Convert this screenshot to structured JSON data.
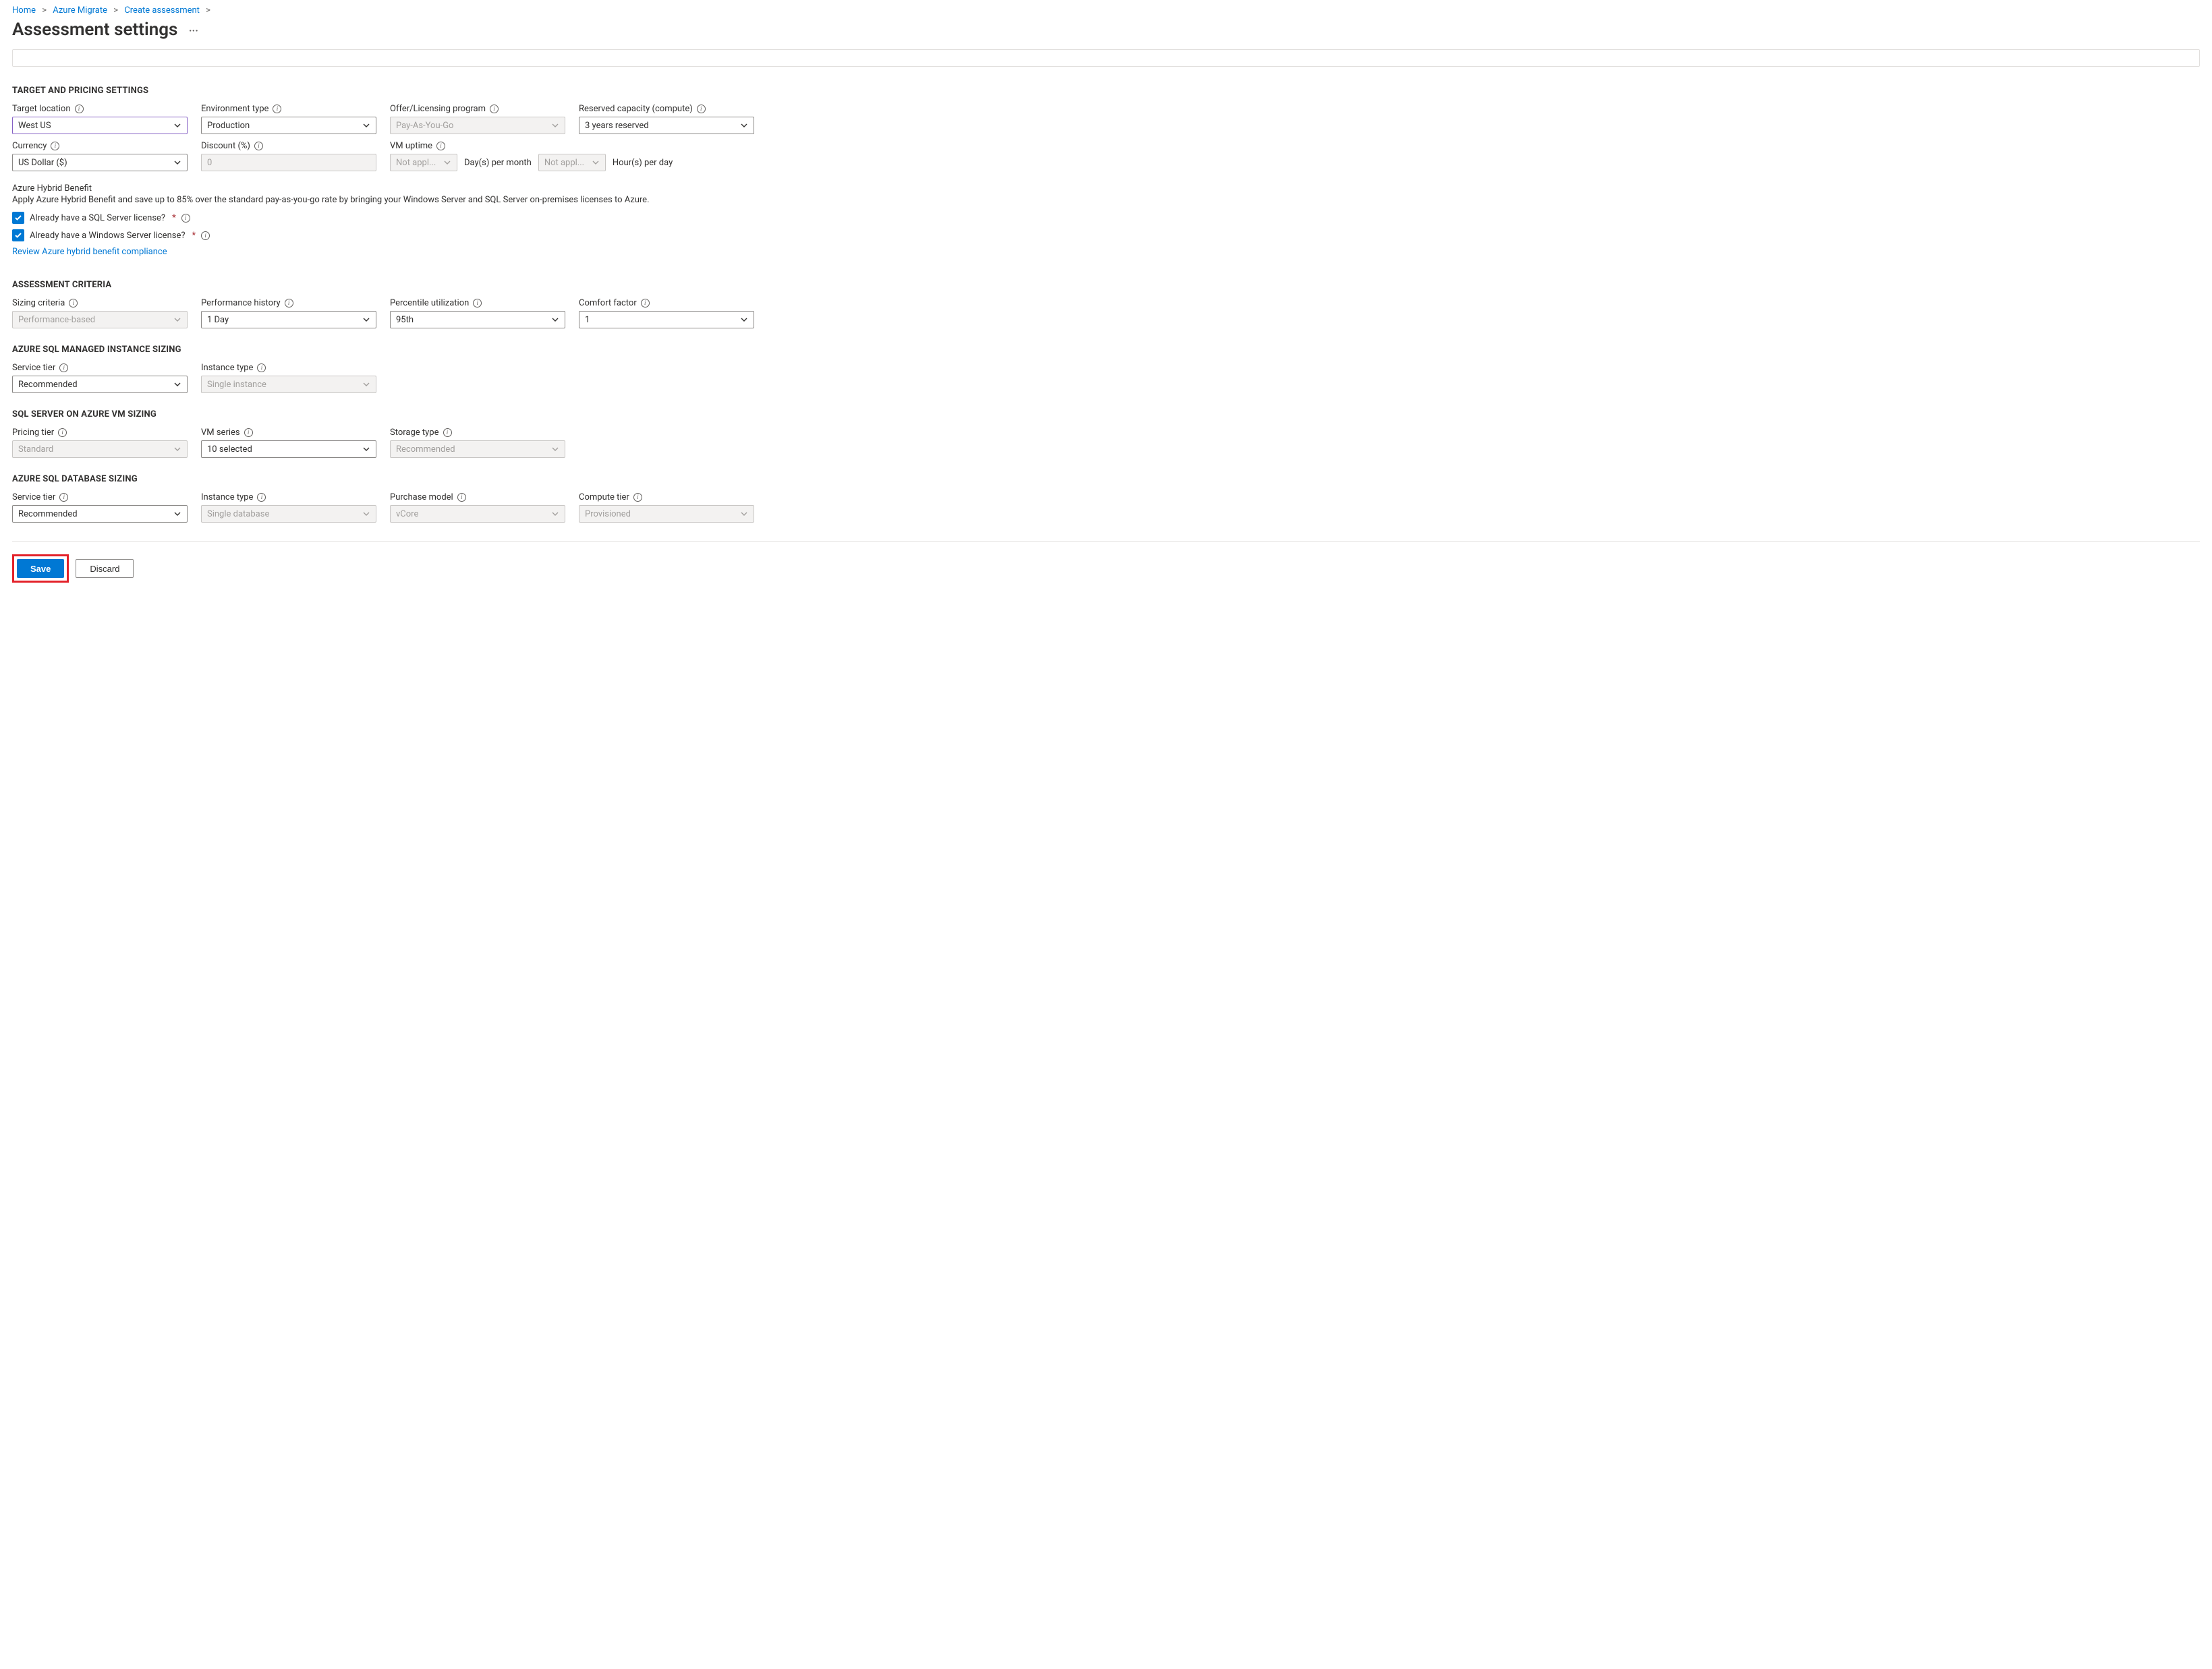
{
  "breadcrumb": {
    "home": "Home",
    "azure_migrate": "Azure Migrate",
    "create_assessment": "Create assessment"
  },
  "title": "Assessment settings",
  "more_glyph": "···",
  "topbox_content": "",
  "sections": {
    "target_pricing": "TARGET AND PRICING SETTINGS",
    "assessment_criteria": "ASSESSMENT CRITERIA",
    "mi_sizing": "AZURE SQL MANAGED INSTANCE SIZING",
    "vm_sizing": "SQL SERVER ON AZURE VM SIZING",
    "db_sizing": "AZURE SQL DATABASE SIZING"
  },
  "fields": {
    "target_location": {
      "label": "Target location",
      "value": "West US"
    },
    "environment_type": {
      "label": "Environment type",
      "value": "Production"
    },
    "offer_program": {
      "label": "Offer/Licensing program",
      "value": "Pay-As-You-Go"
    },
    "reserved_capacity": {
      "label": "Reserved capacity (compute)",
      "value": "3 years reserved"
    },
    "currency": {
      "label": "Currency",
      "value": "US Dollar ($)"
    },
    "discount": {
      "label": "Discount (%)",
      "value": "0"
    },
    "vm_uptime": {
      "label": "VM uptime",
      "days_value": "Not appl...",
      "days_label": "Day(s) per month",
      "hours_value": "Not appl...",
      "hours_label": "Hour(s) per day"
    },
    "sizing_criteria": {
      "label": "Sizing criteria",
      "value": "Performance-based"
    },
    "performance_history": {
      "label": "Performance history",
      "value": "1 Day"
    },
    "percentile_utilization": {
      "label": "Percentile utilization",
      "value": "95th"
    },
    "comfort_factor": {
      "label": "Comfort factor",
      "value": "1"
    },
    "mi_service_tier": {
      "label": "Service tier",
      "value": "Recommended"
    },
    "mi_instance_type": {
      "label": "Instance type",
      "value": "Single instance"
    },
    "vm_pricing_tier": {
      "label": "Pricing tier",
      "value": "Standard"
    },
    "vm_series": {
      "label": "VM series",
      "value": "10 selected"
    },
    "vm_storage_type": {
      "label": "Storage type",
      "value": "Recommended"
    },
    "db_service_tier": {
      "label": "Service tier",
      "value": "Recommended"
    },
    "db_instance_type": {
      "label": "Instance type",
      "value": "Single database"
    },
    "db_purchase_model": {
      "label": "Purchase model",
      "value": "vCore"
    },
    "db_compute_tier": {
      "label": "Compute tier",
      "value": "Provisioned"
    }
  },
  "hybrid": {
    "title": "Azure Hybrid Benefit",
    "desc": "Apply Azure Hybrid Benefit and save up to 85% over the standard pay-as-you-go rate by bringing your Windows Server and SQL Server on-premises licenses to Azure.",
    "sql_license": "Already have a SQL Server license?",
    "win_license": "Already have a Windows Server license?",
    "review_link": "Review Azure hybrid benefit compliance"
  },
  "buttons": {
    "save": "Save",
    "discard": "Discard"
  },
  "glyphs": {
    "info": "i"
  }
}
